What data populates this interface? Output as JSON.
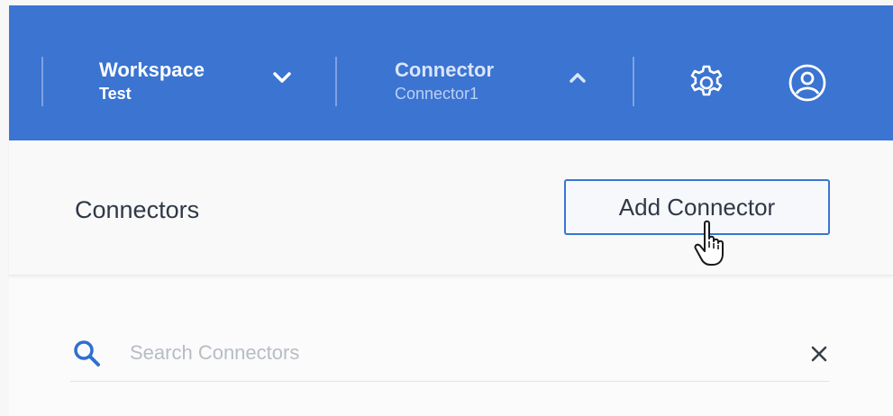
{
  "header": {
    "workspace": {
      "label": "Workspace",
      "value": "Test"
    },
    "connector": {
      "label": "Connector",
      "value": "Connector1"
    },
    "icons": {
      "settings": "gear-icon",
      "account": "user-circle-icon",
      "workspace_toggle": "chevron-down-icon",
      "connector_toggle": "chevron-up-icon"
    }
  },
  "panel": {
    "title": "Connectors",
    "add_button_label": "Add Connector",
    "search": {
      "placeholder": "Search Connectors",
      "value": ""
    }
  },
  "colors": {
    "header_bg": "#3b74d1",
    "accent": "#3b74d1",
    "text": "#303846"
  }
}
